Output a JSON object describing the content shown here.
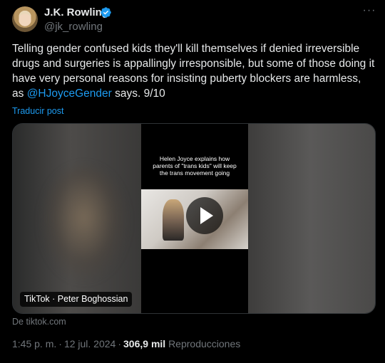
{
  "author": {
    "display_name": "J.K. Rowling",
    "handle": "@jk_rowling"
  },
  "tweet": {
    "text_before_mention": "Telling gender confused kids they'll kill themselves if denied irreversible drugs and surgeries is appallingly irresponsible, but some of those doing it have very personal reasons for insisting puberty blockers are harmless, as ",
    "mention": "@HJoyceGender",
    "text_after_mention": " says. 9/10",
    "translate_label": "Traducir post"
  },
  "media": {
    "overlay_text": "Helen Joyce explains how parents of \"trans kids\" will keep the trans movement going",
    "source_badge": "TikTok · Peter Boghossian",
    "domain_label": "De tiktok.com"
  },
  "meta": {
    "time": "1:45 p. m.",
    "separator": "·",
    "date": "12 jul. 2024",
    "views_count": "306,9 mil",
    "views_label": "Reproducciones"
  },
  "colors": {
    "background": "#000000",
    "text": "#e7e9ea",
    "secondary_text": "#71767b",
    "accent": "#1d9bf0"
  },
  "icons": {
    "verified": "verified-badge-icon",
    "more": "more-options-icon",
    "play": "play-icon"
  }
}
